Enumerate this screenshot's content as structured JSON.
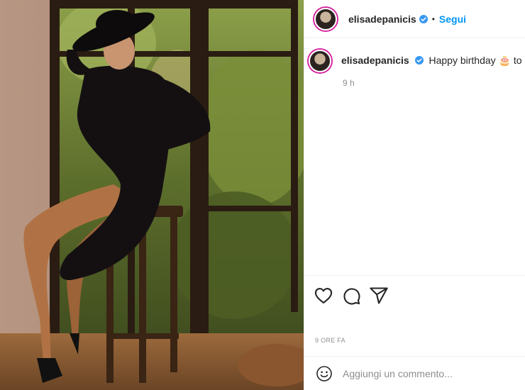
{
  "post": {
    "username": "elisadepanicis",
    "separator": "•",
    "follow_label": "Segui",
    "caption_text": "Happy birthday 🎂 to me",
    "caption_time": "9 h",
    "post_time": "9 ORE FA",
    "comment_placeholder": "Aggiungi un commento...",
    "photo_alt": "Donna con cappello nero e abito nero seduta su uno sgabello vicino a una finestra"
  },
  "colors": {
    "accent": "#0095f6",
    "verified": "#3897f0",
    "text": "#262626",
    "muted": "#8e8e8e",
    "border": "#efefef"
  },
  "icons": [
    "verified-badge-icon",
    "heart-icon",
    "comment-icon",
    "share-icon",
    "emoji-icon"
  ]
}
